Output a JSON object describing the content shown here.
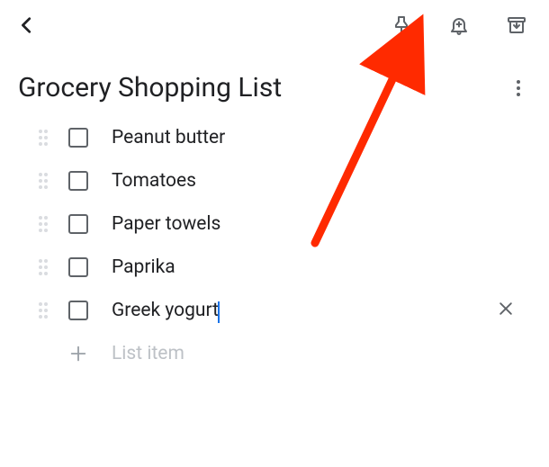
{
  "header": {
    "title": "Grocery Shopping List"
  },
  "list": {
    "items": [
      {
        "label": "Peanut butter",
        "checked": false,
        "active": false
      },
      {
        "label": "Tomatoes",
        "checked": false,
        "active": false
      },
      {
        "label": "Paper towels",
        "checked": false,
        "active": false
      },
      {
        "label": "Paprika",
        "checked": false,
        "active": false
      },
      {
        "label": "Greek yogurt",
        "checked": false,
        "active": true
      }
    ],
    "new_item_placeholder": "List item"
  },
  "icons": {
    "back": "back-chevron",
    "pin": "pin-icon",
    "reminder": "bell-add-icon",
    "archive": "archive-icon",
    "more": "more-vertical-icon",
    "drag": "drag-handle-icon",
    "delete": "close-icon",
    "add": "plus-icon"
  },
  "annotation": {
    "target": "reminder-button",
    "color": "#ff2a00"
  }
}
